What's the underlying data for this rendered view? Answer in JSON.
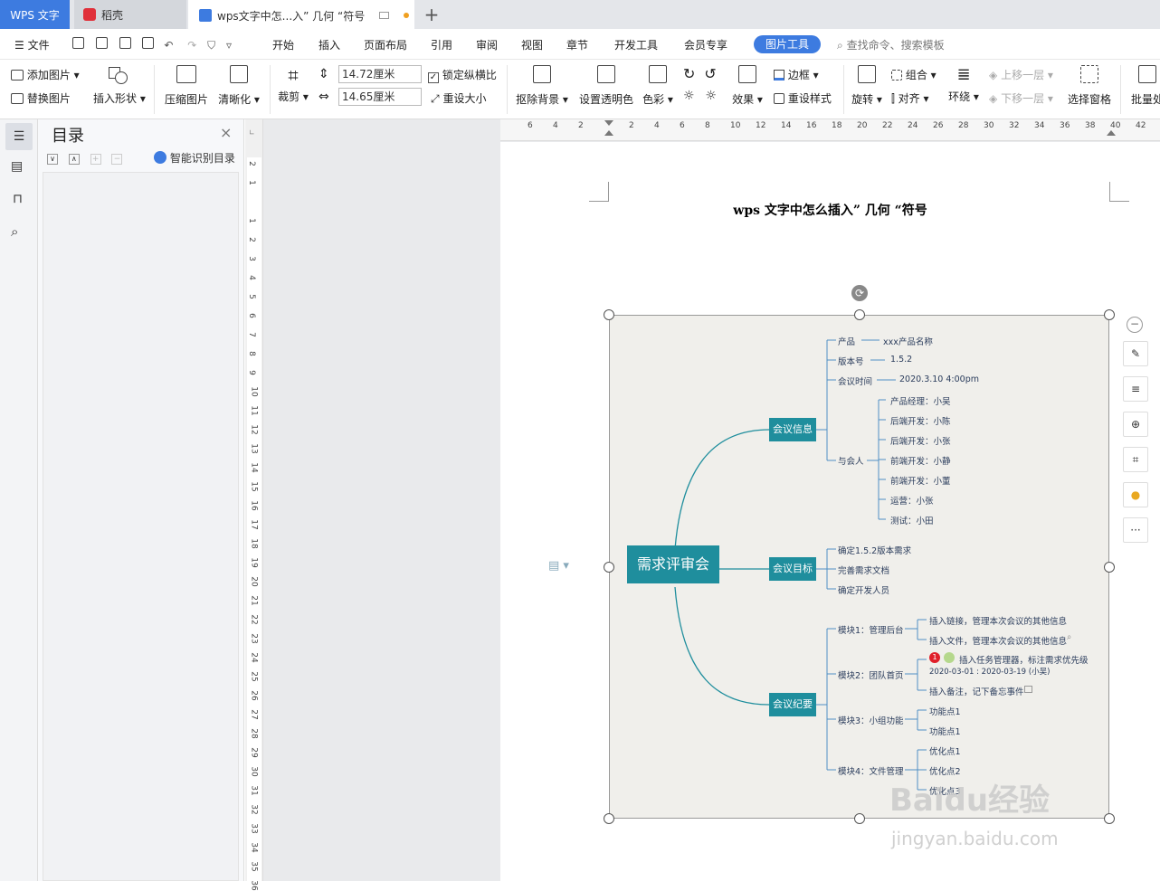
{
  "tabs": {
    "wps": "WPS 文字",
    "daoke": "稻壳",
    "doc": "wps文字中怎...入” 几何 “符号"
  },
  "menu": {
    "file": "文件",
    "items": [
      "开始",
      "插入",
      "页面布局",
      "引用",
      "审阅",
      "视图",
      "章节",
      "开发工具",
      "会员专享"
    ],
    "picture_tools": "图片工具",
    "search_placeholder": "查找命令、搜索模板"
  },
  "ribbon": {
    "add_picture": "添加图片",
    "replace_picture": "替换图片",
    "insert_shape": "插入形状",
    "compress": "压缩图片",
    "sharpen": "清晰化",
    "crop": "裁剪",
    "width": "14.72厘米",
    "height": "14.65厘米",
    "lock_ratio": "锁定纵横比",
    "reset_size": "重设大小",
    "remove_bg": "抠除背景",
    "set_transparent": "设置透明色",
    "color": "色彩",
    "effect": "效果",
    "border": "边框",
    "reset_style": "重设样式",
    "rotate": "旋转",
    "group": "组合",
    "align": "对齐",
    "wrap": "环绕",
    "bring_forward": "上移一层",
    "send_backward": "下移一层",
    "select_pane": "选择窗格",
    "batch": "批量处"
  },
  "toc": {
    "title": "目录",
    "smart": "智能识别目录"
  },
  "document": {
    "title": "wps 文字中怎么插入” 几何 “符号"
  },
  "ruler": {
    "h_ticks": [
      "6",
      "4",
      "2",
      "",
      "2",
      "4",
      "6",
      "8",
      "10",
      "12",
      "14",
      "16",
      "18",
      "20",
      "22",
      "24",
      "26",
      "28",
      "30",
      "32",
      "34",
      "36",
      "38",
      "40",
      "42"
    ],
    "v_ticks": [
      "2",
      "1",
      "",
      "1",
      "2",
      "3",
      "4",
      "5",
      "6",
      "7",
      "8",
      "9",
      "10",
      "11",
      "12",
      "13",
      "14",
      "15",
      "16",
      "17",
      "18",
      "19",
      "20",
      "21",
      "22",
      "23",
      "24",
      "25",
      "26",
      "27",
      "28",
      "29",
      "30",
      "31",
      "32",
      "33",
      "34",
      "35",
      "36"
    ]
  },
  "mindmap": {
    "center": "需求评审会",
    "b1": "会议信息",
    "b2": "会议目标",
    "b3": "会议纪要",
    "product": "产品",
    "product_val": "xxx产品名称",
    "version": "版本号",
    "version_val": "1.5.2",
    "time": "会议时间",
    "time_val": "2020.3.10  4:00pm",
    "attendees": "与会人",
    "people": [
      "产品经理：小吴",
      "后端开发：小陈",
      "后端开发：小张",
      "前端开发：小静",
      "前端开发：小董",
      "运营：小张",
      "测试：小田"
    ],
    "goals": [
      "确定1.5.2版本需求",
      "完善需求文档",
      "确定开发人员"
    ],
    "m1": "模块1：管理后台",
    "m1a": "插入链接，管理本次会议的其他信息",
    "m1b": "插入文件，管理本次会议的其他信息",
    "m2": "模块2：团队首页",
    "m2a": "插入任务管理器，标注需求优先级",
    "m2a_date": "2020-03-01 : 2020-03-19 (小吴)",
    "m2b": "插入备注，记下备忘事件",
    "m3": "模块3：小组功能",
    "m3a": "功能点1",
    "m3b": "功能点1",
    "m4": "模块4：文件管理",
    "m4a": "优化点1",
    "m4b": "优化点2",
    "m4c": "优化点3",
    "priority": "1"
  },
  "watermark": {
    "brand": "Baidu经验",
    "url": "jingyan.baidu.com"
  },
  "colors": {
    "accent": "#3d7be0",
    "node": "#1f8e9d",
    "mapbg": "#f0efeb"
  }
}
